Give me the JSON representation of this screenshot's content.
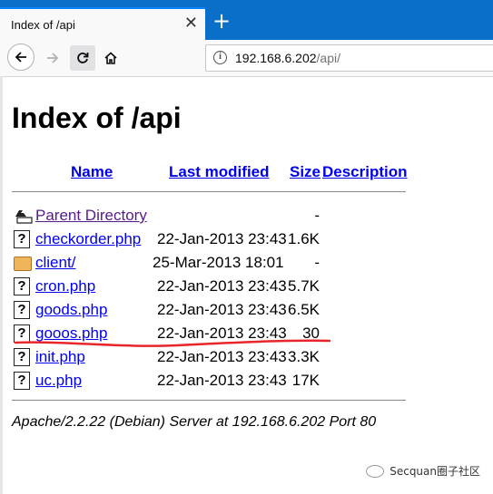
{
  "browser": {
    "tab_title": "Index of /api",
    "close_glyph": "✕",
    "new_tab_glyph": "+",
    "url_host": "192.168.6.202",
    "url_path": "/api/"
  },
  "page": {
    "title": "Index of /api",
    "columns": {
      "name": "Name",
      "last_modified": "Last modified",
      "size": "Size",
      "description": "Description"
    },
    "entries": [
      {
        "name": "Parent Directory",
        "date": "",
        "size": "-",
        "icon": "parent-directory-icon",
        "visited": true
      },
      {
        "name": "checkorder.php",
        "date": "22-Jan-2013 23:43",
        "size": "1.6K",
        "icon": "unknown-file-icon"
      },
      {
        "name": "client/",
        "date": "25-Mar-2013 18:01",
        "size": "-",
        "icon": "folder-icon"
      },
      {
        "name": "cron.php",
        "date": "22-Jan-2013 23:43",
        "size": "5.7K",
        "icon": "unknown-file-icon"
      },
      {
        "name": "goods.php",
        "date": "22-Jan-2013 23:43",
        "size": "6.5K",
        "icon": "unknown-file-icon"
      },
      {
        "name": "gooos.php",
        "date": "22-Jan-2013 23:43",
        "size": "30",
        "icon": "unknown-file-icon"
      },
      {
        "name": "init.php",
        "date": "22-Jan-2013 23:43",
        "size": "3.3K",
        "icon": "unknown-file-icon"
      },
      {
        "name": "uc.php",
        "date": "22-Jan-2013 23:43",
        "size": "17K",
        "icon": "unknown-file-icon"
      }
    ],
    "footer": "Apache/2.2.22 (Debian) Server at 192.168.6.202 Port 80"
  },
  "watermark": "Secquan圈子社区",
  "colors": {
    "tabbar": "#0a6fc9",
    "link": "#0000ee",
    "visited": "#551a8b",
    "annotation": "#e8262a"
  }
}
